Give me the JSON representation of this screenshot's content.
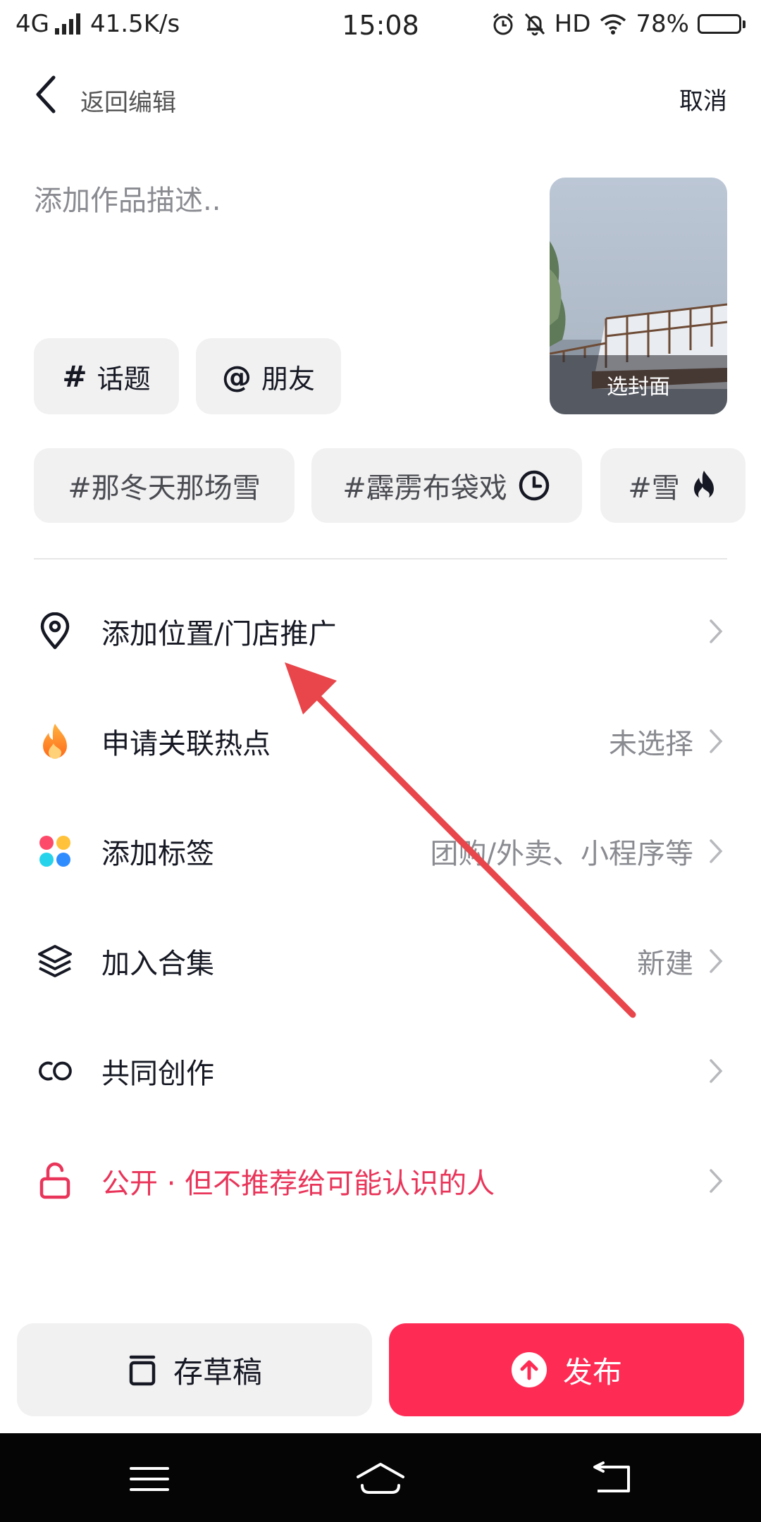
{
  "status_bar": {
    "network": "4G",
    "speed": "41.5K/s",
    "time": "15:08",
    "hd": "HD",
    "battery": "78%",
    "battery_level": 0.78
  },
  "header": {
    "back_label": "返回编辑",
    "cancel_label": "取消"
  },
  "description": {
    "placeholder": "添加作品描述.."
  },
  "chips": {
    "topic": {
      "symbol": "#",
      "label": "话题"
    },
    "friend": {
      "symbol": "@",
      "label": "朋友"
    }
  },
  "cover": {
    "label": "选封面"
  },
  "suggested_tags": [
    {
      "text": "#那冬天那场雪"
    },
    {
      "text": "#霹雳布袋戏",
      "icon": "clock-icon"
    },
    {
      "text": "#雪",
      "icon": "flame-icon"
    }
  ],
  "rows": [
    {
      "icon": "location-pin-icon",
      "label": "添加位置/门店推广",
      "value": ""
    },
    {
      "icon": "hotspot-flame-icon",
      "label": "申请关联热点",
      "value": "未选择"
    },
    {
      "icon": "colorful-dots-icon",
      "label": "添加标签",
      "value": "团购/外卖、小程序等"
    },
    {
      "icon": "layers-icon",
      "label": "加入合集",
      "value": "新建"
    },
    {
      "icon": "co-create-icon",
      "label": "共同创作",
      "value": ""
    },
    {
      "icon": "unlock-icon",
      "label": "公开 · 但不推荐给可能认识的人",
      "value": ""
    }
  ],
  "bottom": {
    "draft_label": "存草稿",
    "publish_label": "发布"
  },
  "colors": {
    "accent": "#fe2c55",
    "privacy_text": "#e9355a",
    "chip_bg": "#f1f1f2",
    "annotation_arrow": "#e8464b"
  }
}
